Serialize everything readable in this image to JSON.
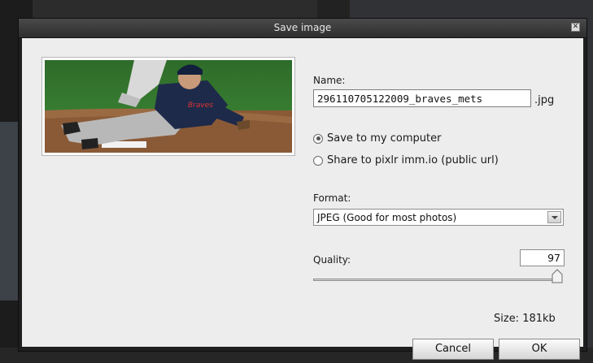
{
  "dialog": {
    "title": "Save image",
    "close_icon": "close-icon"
  },
  "form": {
    "name_label": "Name:",
    "name_value": "296110705122009_braves_mets",
    "extension": ".jpg",
    "save_options": [
      {
        "label": "Save to my computer",
        "checked": true
      },
      {
        "label": "Share to pixlr imm.io (public url)",
        "checked": false
      }
    ],
    "format_label": "Format:",
    "format_value": "JPEG (Good for most photos)",
    "quality_label": "Quality:",
    "quality_value": "97",
    "size_text": "Size: 181kb"
  },
  "buttons": {
    "cancel": "Cancel",
    "ok": "OK"
  },
  "colors": {
    "panel": "#ededed",
    "titlebar": "#3a3a3a"
  }
}
